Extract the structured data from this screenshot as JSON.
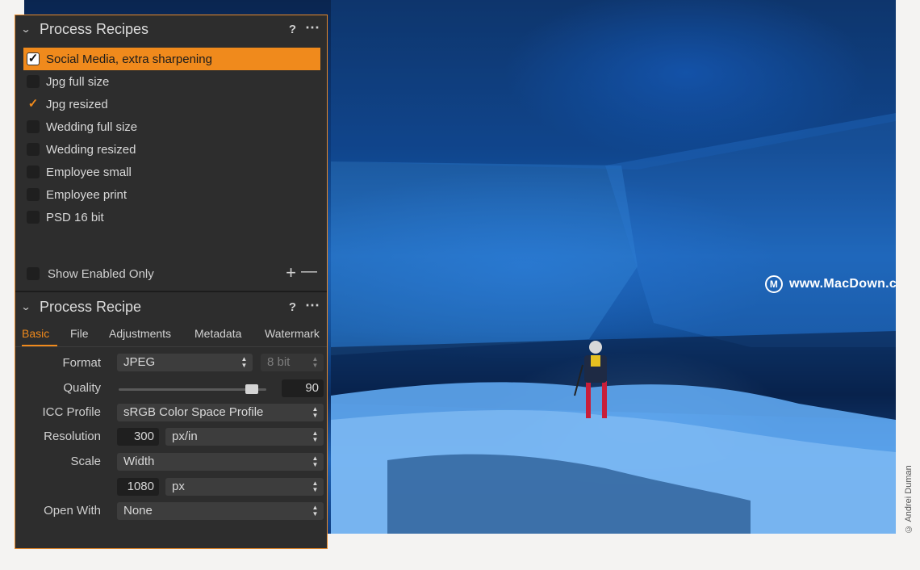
{
  "photo": {
    "watermark_text": "www.MacDown.com",
    "watermark_icon": "M",
    "credit": "© Andrei Duman"
  },
  "recipes_panel": {
    "title": "Process Recipes",
    "help": "?",
    "more": "⋯",
    "items": [
      {
        "label": "Social Media, extra sharpening",
        "checked": true,
        "selected": true
      },
      {
        "label": "Jpg full size",
        "checked": false,
        "selected": false
      },
      {
        "label": "Jpg resized",
        "checked": true,
        "selected": false
      },
      {
        "label": "Wedding full size",
        "checked": false,
        "selected": false
      },
      {
        "label": "Wedding resized",
        "checked": false,
        "selected": false
      },
      {
        "label": "Employee small",
        "checked": false,
        "selected": false
      },
      {
        "label": "Employee print",
        "checked": false,
        "selected": false
      },
      {
        "label": "PSD 16 bit",
        "checked": false,
        "selected": false
      }
    ],
    "show_enabled_only": "Show Enabled Only",
    "add": "+",
    "remove": "—"
  },
  "recipe_panel": {
    "title": "Process Recipe",
    "help": "?",
    "more": "⋯",
    "tabs": [
      "Basic",
      "File",
      "Adjustments",
      "Metadata",
      "Watermark"
    ],
    "active_tab": "Basic",
    "format_label": "Format",
    "format_value": "JPEG",
    "bit_depth": "8 bit",
    "quality_label": "Quality",
    "quality_value": "90",
    "quality_fraction": 0.9,
    "icc_label": "ICC Profile",
    "icc_value": "sRGB Color Space Profile",
    "resolution_label": "Resolution",
    "resolution_value": "300",
    "resolution_unit": "px/in",
    "scale_label": "Scale",
    "scale_value": "Width",
    "scale_size": "1080",
    "scale_unit": "px",
    "open_with_label": "Open With",
    "open_with_value": "None"
  },
  "colors": {
    "accent": "#f08a1c",
    "panel_bg": "#2d2d2d",
    "field_bg": "#3d3d3d"
  }
}
